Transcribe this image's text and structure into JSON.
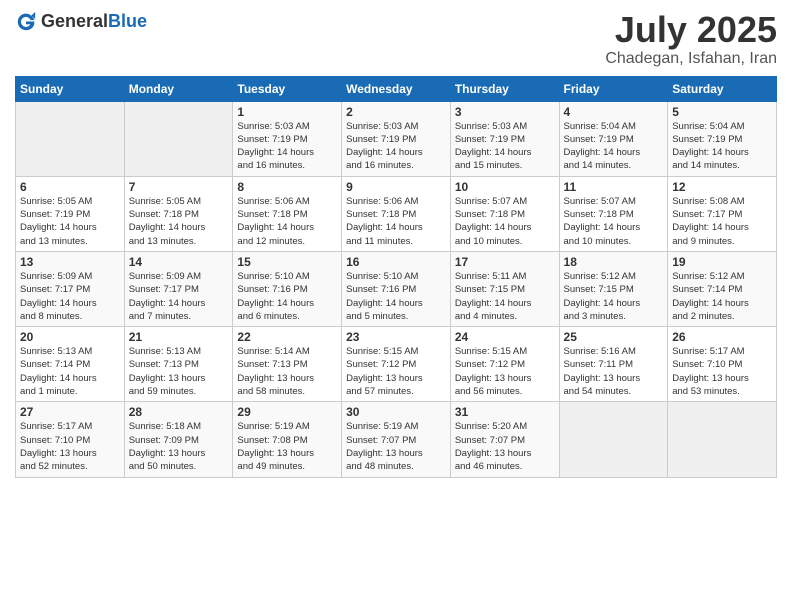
{
  "header": {
    "logo": {
      "general": "General",
      "blue": "Blue"
    },
    "month": "July 2025",
    "location": "Chadegan, Isfahan, Iran"
  },
  "weekdays": [
    "Sunday",
    "Monday",
    "Tuesday",
    "Wednesday",
    "Thursday",
    "Friday",
    "Saturday"
  ],
  "weeks": [
    [
      {
        "day": "",
        "detail": ""
      },
      {
        "day": "",
        "detail": ""
      },
      {
        "day": "1",
        "detail": "Sunrise: 5:03 AM\nSunset: 7:19 PM\nDaylight: 14 hours\nand 16 minutes."
      },
      {
        "day": "2",
        "detail": "Sunrise: 5:03 AM\nSunset: 7:19 PM\nDaylight: 14 hours\nand 16 minutes."
      },
      {
        "day": "3",
        "detail": "Sunrise: 5:03 AM\nSunset: 7:19 PM\nDaylight: 14 hours\nand 15 minutes."
      },
      {
        "day": "4",
        "detail": "Sunrise: 5:04 AM\nSunset: 7:19 PM\nDaylight: 14 hours\nand 14 minutes."
      },
      {
        "day": "5",
        "detail": "Sunrise: 5:04 AM\nSunset: 7:19 PM\nDaylight: 14 hours\nand 14 minutes."
      }
    ],
    [
      {
        "day": "6",
        "detail": "Sunrise: 5:05 AM\nSunset: 7:19 PM\nDaylight: 14 hours\nand 13 minutes."
      },
      {
        "day": "7",
        "detail": "Sunrise: 5:05 AM\nSunset: 7:18 PM\nDaylight: 14 hours\nand 13 minutes."
      },
      {
        "day": "8",
        "detail": "Sunrise: 5:06 AM\nSunset: 7:18 PM\nDaylight: 14 hours\nand 12 minutes."
      },
      {
        "day": "9",
        "detail": "Sunrise: 5:06 AM\nSunset: 7:18 PM\nDaylight: 14 hours\nand 11 minutes."
      },
      {
        "day": "10",
        "detail": "Sunrise: 5:07 AM\nSunset: 7:18 PM\nDaylight: 14 hours\nand 10 minutes."
      },
      {
        "day": "11",
        "detail": "Sunrise: 5:07 AM\nSunset: 7:18 PM\nDaylight: 14 hours\nand 10 minutes."
      },
      {
        "day": "12",
        "detail": "Sunrise: 5:08 AM\nSunset: 7:17 PM\nDaylight: 14 hours\nand 9 minutes."
      }
    ],
    [
      {
        "day": "13",
        "detail": "Sunrise: 5:09 AM\nSunset: 7:17 PM\nDaylight: 14 hours\nand 8 minutes."
      },
      {
        "day": "14",
        "detail": "Sunrise: 5:09 AM\nSunset: 7:17 PM\nDaylight: 14 hours\nand 7 minutes."
      },
      {
        "day": "15",
        "detail": "Sunrise: 5:10 AM\nSunset: 7:16 PM\nDaylight: 14 hours\nand 6 minutes."
      },
      {
        "day": "16",
        "detail": "Sunrise: 5:10 AM\nSunset: 7:16 PM\nDaylight: 14 hours\nand 5 minutes."
      },
      {
        "day": "17",
        "detail": "Sunrise: 5:11 AM\nSunset: 7:15 PM\nDaylight: 14 hours\nand 4 minutes."
      },
      {
        "day": "18",
        "detail": "Sunrise: 5:12 AM\nSunset: 7:15 PM\nDaylight: 14 hours\nand 3 minutes."
      },
      {
        "day": "19",
        "detail": "Sunrise: 5:12 AM\nSunset: 7:14 PM\nDaylight: 14 hours\nand 2 minutes."
      }
    ],
    [
      {
        "day": "20",
        "detail": "Sunrise: 5:13 AM\nSunset: 7:14 PM\nDaylight: 14 hours\nand 1 minute."
      },
      {
        "day": "21",
        "detail": "Sunrise: 5:13 AM\nSunset: 7:13 PM\nDaylight: 13 hours\nand 59 minutes."
      },
      {
        "day": "22",
        "detail": "Sunrise: 5:14 AM\nSunset: 7:13 PM\nDaylight: 13 hours\nand 58 minutes."
      },
      {
        "day": "23",
        "detail": "Sunrise: 5:15 AM\nSunset: 7:12 PM\nDaylight: 13 hours\nand 57 minutes."
      },
      {
        "day": "24",
        "detail": "Sunrise: 5:15 AM\nSunset: 7:12 PM\nDaylight: 13 hours\nand 56 minutes."
      },
      {
        "day": "25",
        "detail": "Sunrise: 5:16 AM\nSunset: 7:11 PM\nDaylight: 13 hours\nand 54 minutes."
      },
      {
        "day": "26",
        "detail": "Sunrise: 5:17 AM\nSunset: 7:10 PM\nDaylight: 13 hours\nand 53 minutes."
      }
    ],
    [
      {
        "day": "27",
        "detail": "Sunrise: 5:17 AM\nSunset: 7:10 PM\nDaylight: 13 hours\nand 52 minutes."
      },
      {
        "day": "28",
        "detail": "Sunrise: 5:18 AM\nSunset: 7:09 PM\nDaylight: 13 hours\nand 50 minutes."
      },
      {
        "day": "29",
        "detail": "Sunrise: 5:19 AM\nSunset: 7:08 PM\nDaylight: 13 hours\nand 49 minutes."
      },
      {
        "day": "30",
        "detail": "Sunrise: 5:19 AM\nSunset: 7:07 PM\nDaylight: 13 hours\nand 48 minutes."
      },
      {
        "day": "31",
        "detail": "Sunrise: 5:20 AM\nSunset: 7:07 PM\nDaylight: 13 hours\nand 46 minutes."
      },
      {
        "day": "",
        "detail": ""
      },
      {
        "day": "",
        "detail": ""
      }
    ]
  ]
}
